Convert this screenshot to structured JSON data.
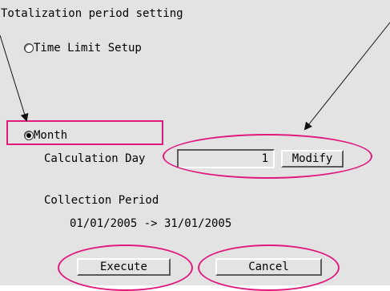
{
  "dialog": {
    "title": "Totalization period setting",
    "time_limit_label": "Time Limit Setup",
    "month_label": "Month",
    "calc_day_label": "Calculation Day",
    "calc_day_value": "1",
    "modify_label": "Modify",
    "collection_period_label": "Collection Period",
    "collection_period_value": "01/01/2005 -> 31/01/2005",
    "execute_label": "Execute",
    "cancel_label": "Cancel",
    "selected_option": "Month"
  },
  "colors": {
    "highlight": "#e0197d",
    "panel": "#e3e3e3"
  }
}
